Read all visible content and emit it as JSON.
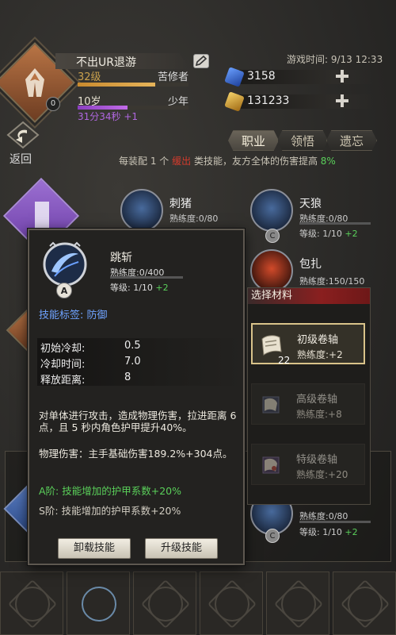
{
  "player": {
    "name": "不出UR退游",
    "level": "32级",
    "level_title": "苦修者",
    "age": "10岁",
    "age_title": "少年",
    "timer": "31分34秒 +1",
    "badge": "0"
  },
  "game_time": "游戏时间: 9/13 12:33",
  "resources": [
    {
      "value": "3158",
      "color": "#3a6fd0"
    },
    {
      "value": "131233",
      "color": "#d4a230"
    }
  ],
  "back_label": "返回",
  "tabs": [
    "职业",
    "领悟",
    "遗忘"
  ],
  "equip_hint": {
    "prefix": "每装配 1 个",
    "highlight": "缓出",
    "middle": "类技能，友方全体的伤害提高 ",
    "bonus": "8%"
  },
  "bg_skills": [
    {
      "name": "刺猪",
      "prof": "熟练度:0/80",
      "level": "",
      "bonus": ""
    },
    {
      "name": "天狼",
      "prof": "熟练度:0/80",
      "level": "等级: 1/10 ",
      "bonus": "+2",
      "grade": "C"
    },
    {
      "name": "包扎",
      "prof": "熟练度:150/150"
    },
    {
      "prof": "熟练度:0/80",
      "level": "等级: 1/10 ",
      "bonus": "+2",
      "grade": "C"
    }
  ],
  "popup": {
    "name": "跳斩",
    "grade": "A",
    "proficiency": "熟练度:0/400",
    "level": "等级: 1/10 ",
    "level_bonus": "+2",
    "tag": "技能标签: 防御",
    "stats": [
      {
        "k": "初始冷却:",
        "v": "0.5"
      },
      {
        "k": "冷却时间:",
        "v": "7.0"
      },
      {
        "k": "释放距离:",
        "v": "8"
      }
    ],
    "desc1": "对单体进行攻击，造成物理伤害，拉进距离 6 点，且 5 秒内角色护甲提升40%。",
    "desc2": "物理伤害：主手基础伤害189.2%+304点。",
    "rank_a": "A阶: 技能增加的护甲系数+20%",
    "rank_s": "S阶: 技能增加的护甲系数+20%",
    "btn_unload": "卸载技能",
    "btn_upgrade": "升级技能"
  },
  "materials": {
    "title": "选择材料",
    "items": [
      {
        "name": "初级卷轴",
        "prof": "熟练度:+2",
        "qty": "22"
      },
      {
        "name": "高级卷轴",
        "prof": "熟练度:+8",
        "qty": ""
      },
      {
        "name": "特级卷轴",
        "prof": "熟练度:+20",
        "qty": ""
      }
    ]
  }
}
